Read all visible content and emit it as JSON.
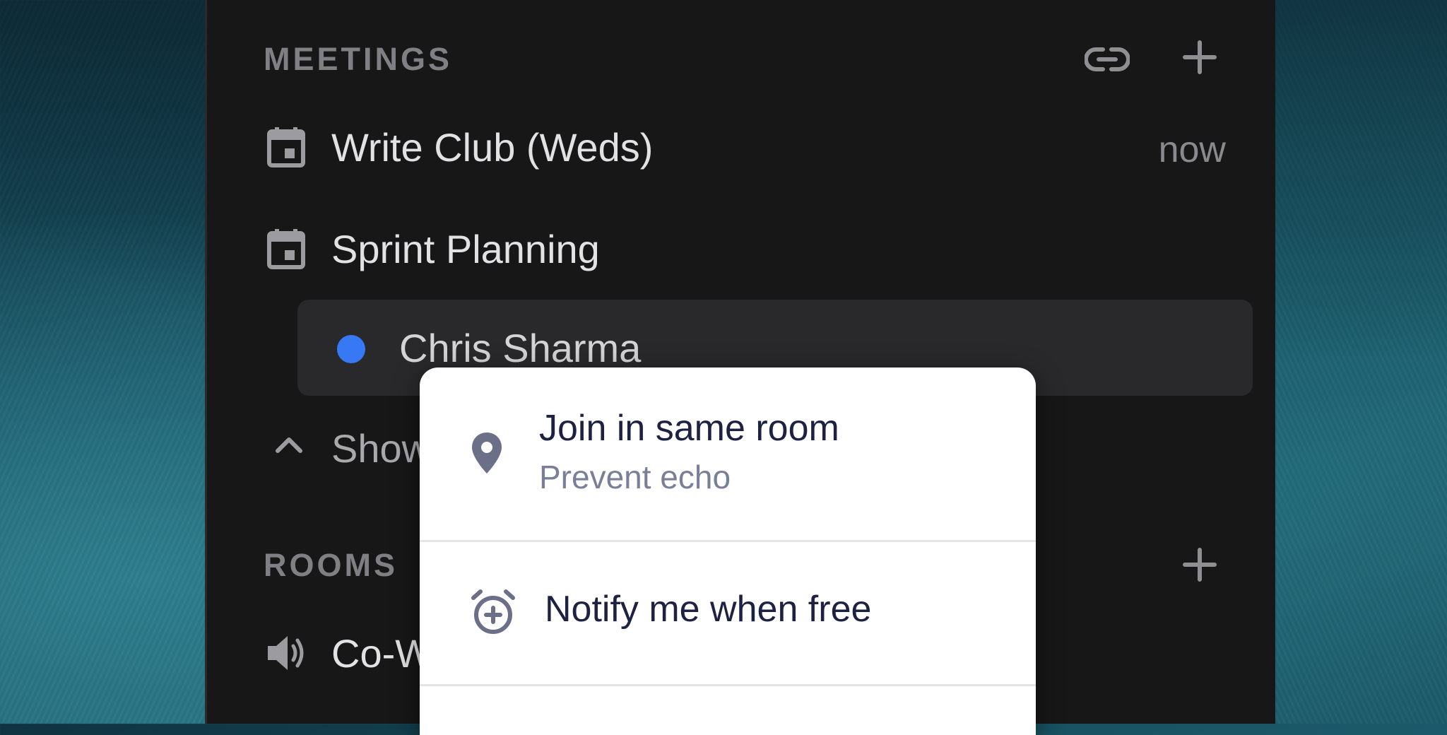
{
  "meetings": {
    "header": "MEETINGS",
    "header_icons": [
      "link-icon",
      "plus-icon"
    ],
    "items": [
      {
        "icon": "calendar-icon",
        "label": "Write Club (Weds)",
        "time": "now"
      },
      {
        "icon": "calendar-icon",
        "label": "Sprint Planning",
        "time": ""
      }
    ],
    "participant": {
      "name": "Chris Sharma",
      "status_color": "#3778f5"
    },
    "show_toggle": {
      "icon": "chevron-up-icon",
      "label": "Show"
    }
  },
  "rooms": {
    "header": "ROOMS",
    "header_icons": [
      "plus-icon"
    ],
    "items": [
      {
        "icon": "speaker-icon",
        "label": "Co-W"
      }
    ]
  },
  "context_menu": {
    "items": [
      {
        "icon": "location-pin-icon",
        "title": "Join in same room",
        "subtitle": "Prevent echo"
      },
      {
        "icon": "alarm-plus-icon",
        "title": "Notify me when free",
        "subtitle": ""
      }
    ]
  },
  "colors": {
    "panel_bg": "#171718",
    "selected_row_bg": "#29292c",
    "presence": "#3778f5",
    "menu_bg": "#ffffff",
    "menu_text": "#1e2242",
    "menu_subtext": "#7a7f98"
  }
}
